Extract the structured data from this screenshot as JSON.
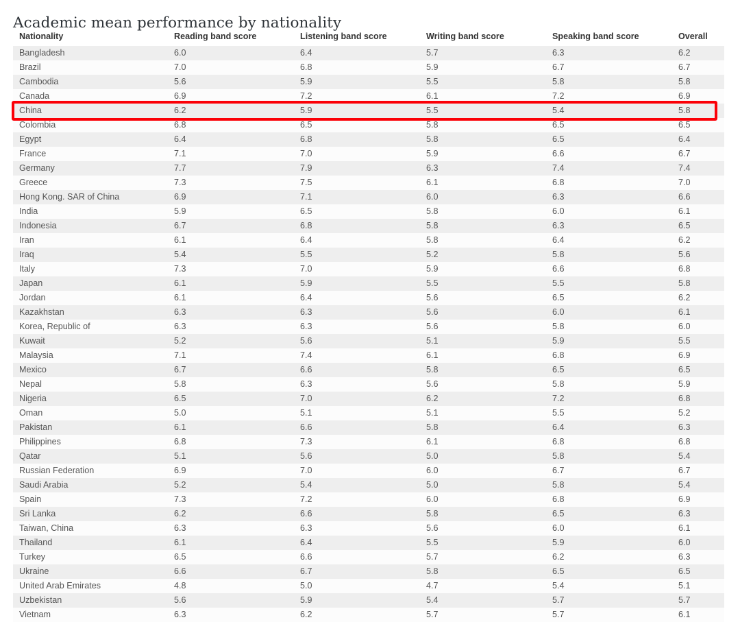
{
  "page": {
    "title": "Academic mean performance by nationality"
  },
  "table": {
    "columns": [
      "Nationality",
      "Reading band score",
      "Listening band score",
      "Writing band score",
      "Speaking band score",
      "Overall"
    ],
    "highlighted_row": "China",
    "highlight_color": "#fb0007",
    "rows": [
      [
        "Bangladesh",
        "6.0",
        "6.4",
        "5.7",
        "6.3",
        "6.2"
      ],
      [
        "Brazil",
        "7.0",
        "6.8",
        "5.9",
        "6.7",
        "6.7"
      ],
      [
        "Cambodia",
        "5.6",
        "5.9",
        "5.5",
        "5.8",
        "5.8"
      ],
      [
        "Canada",
        "6.9",
        "7.2",
        "6.1",
        "7.2",
        "6.9"
      ],
      [
        "China",
        "6.2",
        "5.9",
        "5.5",
        "5.4",
        "5.8"
      ],
      [
        "Colombia",
        "6.8",
        "6.5",
        "5.8",
        "6.5",
        "6.5"
      ],
      [
        "Egypt",
        "6.4",
        "6.8",
        "5.8",
        "6.5",
        "6.4"
      ],
      [
        "France",
        "7.1",
        "7.0",
        "5.9",
        "6.6",
        "6.7"
      ],
      [
        "Germany",
        "7.7",
        "7.9",
        "6.3",
        "7.4",
        "7.4"
      ],
      [
        "Greece",
        "7.3",
        "7.5",
        "6.1",
        "6.8",
        "7.0"
      ],
      [
        "Hong Kong. SAR of China",
        "6.9",
        "7.1",
        "6.0",
        "6.3",
        "6.6"
      ],
      [
        "India",
        "5.9",
        "6.5",
        "5.8",
        "6.0",
        "6.1"
      ],
      [
        "Indonesia",
        "6.7",
        "6.8",
        "5.8",
        "6.3",
        "6.5"
      ],
      [
        "Iran",
        "6.1",
        "6.4",
        "5.8",
        "6.4",
        "6.2"
      ],
      [
        "Iraq",
        "5.4",
        "5.5",
        "5.2",
        "5.8",
        "5.6"
      ],
      [
        "Italy",
        "7.3",
        "7.0",
        "5.9",
        "6.6",
        "6.8"
      ],
      [
        "Japan",
        "6.1",
        "5.9",
        "5.5",
        "5.5",
        "5.8"
      ],
      [
        "Jordan",
        "6.1",
        "6.4",
        "5.6",
        "6.5",
        "6.2"
      ],
      [
        "Kazakhstan",
        "6.3",
        "6.3",
        "5.6",
        "6.0",
        "6.1"
      ],
      [
        "Korea, Republic of",
        "6.3",
        "6.3",
        "5.6",
        "5.8",
        "6.0"
      ],
      [
        "Kuwait",
        "5.2",
        "5.6",
        "5.1",
        "5.9",
        "5.5"
      ],
      [
        "Malaysia",
        "7.1",
        "7.4",
        "6.1",
        "6.8",
        "6.9"
      ],
      [
        "Mexico",
        "6.7",
        "6.6",
        "5.8",
        "6.5",
        "6.5"
      ],
      [
        "Nepal",
        "5.8",
        "6.3",
        "5.6",
        "5.8",
        "5.9"
      ],
      [
        "Nigeria",
        "6.5",
        "7.0",
        "6.2",
        "7.2",
        "6.8"
      ],
      [
        "Oman",
        "5.0",
        "5.1",
        "5.1",
        "5.5",
        "5.2"
      ],
      [
        "Pakistan",
        "6.1",
        "6.6",
        "5.8",
        "6.4",
        "6.3"
      ],
      [
        "Philippines",
        "6.8",
        "7.3",
        "6.1",
        "6.8",
        "6.8"
      ],
      [
        "Qatar",
        "5.1",
        "5.6",
        "5.0",
        "5.8",
        "5.4"
      ],
      [
        "Russian Federation",
        "6.9",
        "7.0",
        "6.0",
        "6.7",
        "6.7"
      ],
      [
        "Saudi Arabia",
        "5.2",
        "5.4",
        "5.0",
        "5.8",
        "5.4"
      ],
      [
        "Spain",
        "7.3",
        "7.2",
        "6.0",
        "6.8",
        "6.9"
      ],
      [
        "Sri Lanka",
        "6.2",
        "6.6",
        "5.8",
        "6.5",
        "6.3"
      ],
      [
        "Taiwan, China",
        "6.3",
        "6.3",
        "5.6",
        "6.0",
        "6.1"
      ],
      [
        "Thailand",
        "6.1",
        "6.4",
        "5.5",
        "5.9",
        "6.0"
      ],
      [
        "Turkey",
        "6.5",
        "6.6",
        "5.7",
        "6.2",
        "6.3"
      ],
      [
        "Ukraine",
        "6.6",
        "6.7",
        "5.8",
        "6.5",
        "6.5"
      ],
      [
        "United Arab Emirates",
        "4.8",
        "5.0",
        "4.7",
        "5.4",
        "5.1"
      ],
      [
        "Uzbekistan",
        "5.6",
        "5.9",
        "5.4",
        "5.7",
        "5.7"
      ],
      [
        "Vietnam",
        "6.3",
        "6.2",
        "5.7",
        "5.7",
        "6.1"
      ]
    ]
  }
}
